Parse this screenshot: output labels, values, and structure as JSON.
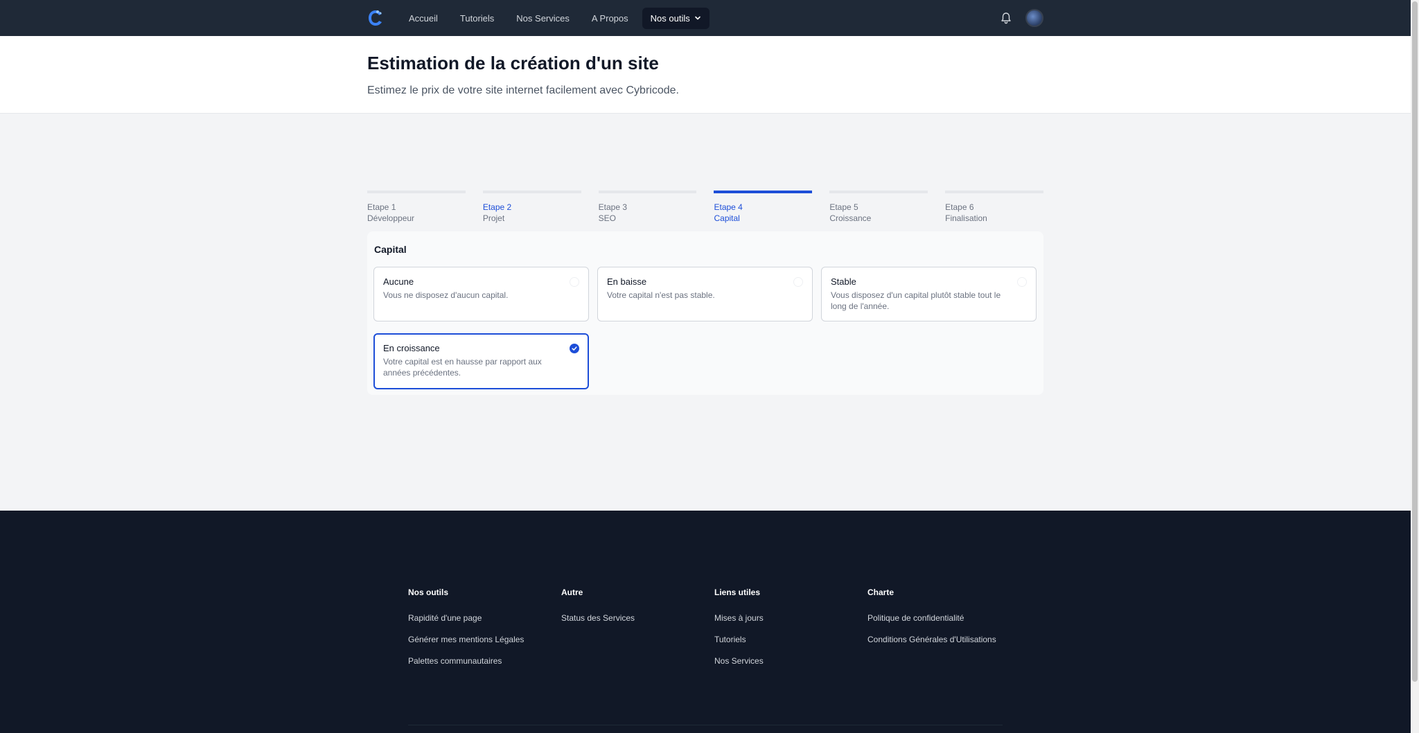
{
  "nav": {
    "links": [
      "Accueil",
      "Tutoriels",
      "Nos Services",
      "A Propos"
    ],
    "tools_label": "Nos outils"
  },
  "header": {
    "title": "Estimation de la création d'un site",
    "subtitle": "Estimez le prix de votre site internet facilement avec Cybricode."
  },
  "steps": [
    {
      "number": "Etape 1",
      "name": "Développeur"
    },
    {
      "number": "Etape 2",
      "name": "Projet"
    },
    {
      "number": "Etape 3",
      "name": "SEO"
    },
    {
      "number": "Etape 4",
      "name": "Capital"
    },
    {
      "number": "Etape 5",
      "name": "Croissance"
    },
    {
      "number": "Etape 6",
      "name": "Finalisation"
    }
  ],
  "panel": {
    "title": "Capital",
    "options": [
      {
        "title": "Aucune",
        "desc": "Vous ne disposez d'aucun capital."
      },
      {
        "title": "En baisse",
        "desc": "Votre capital n'est pas stable."
      },
      {
        "title": "Stable",
        "desc": "Vous disposez d'un capital plutôt stable tout le long de l'année."
      },
      {
        "title": "En croissance",
        "desc": "Votre capital est en hausse par rapport aux années précédentes."
      }
    ]
  },
  "footer": {
    "columns": [
      {
        "heading": "Nos outils",
        "links": [
          "Rapidité d'une page",
          "Générer mes mentions Légales",
          "Palettes communautaires"
        ]
      },
      {
        "heading": "Autre",
        "links": [
          "Status des Services"
        ]
      },
      {
        "heading": "Liens utiles",
        "links": [
          "Mises à jours",
          "Tutoriels",
          "Nos Services"
        ]
      },
      {
        "heading": "Charte",
        "links": [
          "Politique de confidentialité",
          "Conditions Générales d'Utilisations"
        ]
      }
    ]
  },
  "colors": {
    "nav_bg": "#1f2937",
    "accent": "#1d4ed8",
    "footer_bg": "#111827",
    "page_bg": "#f3f4f6"
  }
}
